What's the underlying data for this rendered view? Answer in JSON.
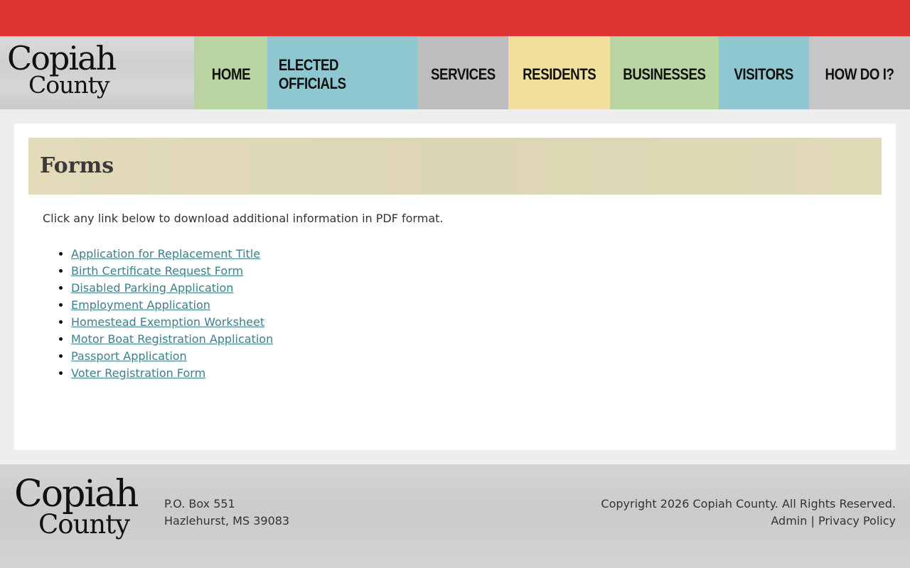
{
  "header": {
    "logo": {
      "line1": "Copiah",
      "line2": "County"
    },
    "nav": [
      {
        "label": "HOME"
      },
      {
        "label": "ELECTED OFFICIALS"
      },
      {
        "label": "SERVICES"
      },
      {
        "label": "RESIDENTS"
      },
      {
        "label": "BUSINESSES"
      },
      {
        "label": "VISITORS"
      },
      {
        "label": "HOW DO I?"
      }
    ]
  },
  "main": {
    "title": "Forms",
    "intro": "Click any link below to download additional information in PDF format.",
    "forms": [
      "Application for Replacement Title",
      "Birth Certificate Request Form",
      "Disabled Parking Application",
      "Employment Application",
      "Homestead Exemption Worksheet",
      "Motor Boat Registration Application",
      "Passport Application",
      "Voter Registration Form"
    ]
  },
  "footer": {
    "logo": {
      "line1": "Copiah",
      "line2": "County"
    },
    "address_line1": "P.O. Box 551",
    "address_line2": "Hazlehurst, MS 39083",
    "copyright": "Copyright 2026 Copiah County. All Rights Reserved.",
    "admin_link": "Admin",
    "separator": "|",
    "privacy_link": "Privacy Policy"
  },
  "colors": {
    "top_bar": "#e03333",
    "nav_green": "#b9d3a1",
    "nav_blue": "#8ec7cf",
    "nav_gray": "#bdbdbd",
    "nav_yellow": "#f1e09c",
    "link": "#3f7e8a",
    "title_bar": "#e2dab8"
  }
}
